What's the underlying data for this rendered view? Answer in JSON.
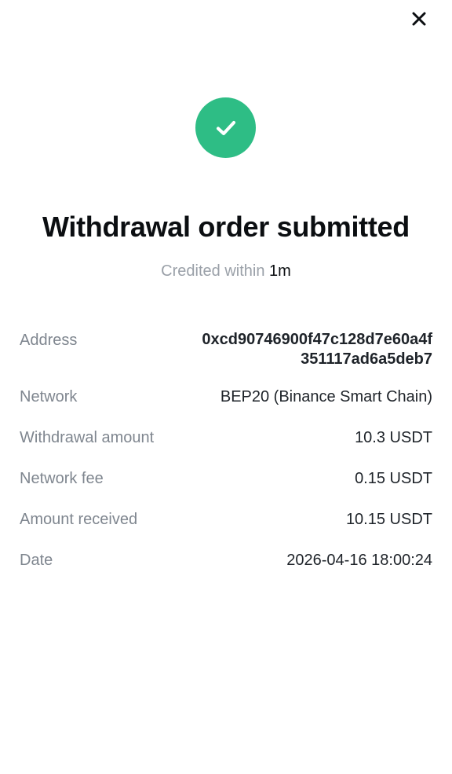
{
  "header": {
    "close_icon": "close-icon"
  },
  "status": {
    "icon": "checkmark-icon",
    "color": "#2ebd85",
    "title": "Withdrawal order submitted",
    "credited_prefix": "Credited within",
    "credited_time": "1m"
  },
  "details": {
    "address": {
      "label": "Address",
      "value": "0xcd90746900f47c128d7e60a4f351117ad6a5deb7"
    },
    "network": {
      "label": "Network",
      "value": "BEP20 (Binance Smart Chain)"
    },
    "withdrawal_amount": {
      "label": "Withdrawal amount",
      "value": "10.3 USDT"
    },
    "network_fee": {
      "label": "Network fee",
      "value": "0.15 USDT"
    },
    "amount_received": {
      "label": "Amount received",
      "value": "10.15 USDT"
    },
    "date": {
      "label": "Date",
      "value": "2026-04-16 18:00:24"
    }
  }
}
